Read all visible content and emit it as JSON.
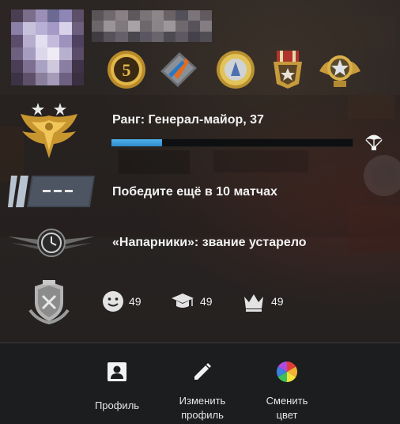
{
  "profile": {
    "rank_text": "Ранг: Генерал-майор, 37",
    "rank_progress": 0.21,
    "wins_text": "Победите ещё в 10 матчах",
    "wingman_text": "«Напарники»: звание устарело"
  },
  "commendations": {
    "friendly": "49",
    "teacher": "49",
    "leader": "49"
  },
  "medals": [
    {
      "icon": "five-year-coin-icon"
    },
    {
      "icon": "operation-coin-icon"
    },
    {
      "icon": "tournament-coin-icon"
    },
    {
      "icon": "service-medal-icon"
    },
    {
      "icon": "star-service-medal-icon"
    }
  ],
  "actions": {
    "profile": "Профиль",
    "edit_line1": "Изменить",
    "edit_line2": "профиль",
    "color_line1": "Сменить",
    "color_line2": "цвет"
  },
  "colors": {
    "progress": "#3a9ad9",
    "accent_gold": "#d4a739",
    "bottom_bar": "#1c1d1f"
  }
}
